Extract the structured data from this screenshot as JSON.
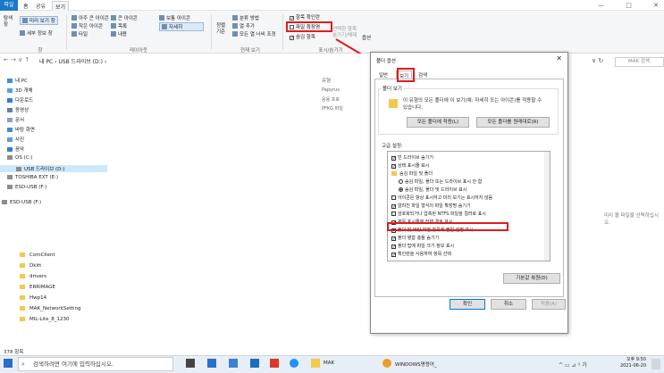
{
  "ribbon_tabs": {
    "file": "파일",
    "home": "홈",
    "share": "공유",
    "view": "보기"
  },
  "ribbon": {
    "nav_pane": "탐색\n창",
    "preview": "미리 보기 창",
    "details_pane": "세부 정보 창",
    "pane_group": "창",
    "layout": {
      "xl_icons": "아주 큰 아이콘",
      "large_icons": "큰 아이콘",
      "medium_icons": "보통 아이콘",
      "small_icons": "작은 아이콘",
      "list": "목록",
      "details": "자세히",
      "tiles": "타일",
      "content": "내용",
      "group": "레이아웃"
    },
    "current_view": {
      "sort": "정렬\n기준",
      "group_by": "분류 방법",
      "add_columns": "열 추가",
      "fit_columns": "모든 열 너비 조정",
      "group": "현재 보기"
    },
    "show_hide": {
      "item_checkboxes": "항목 확인란",
      "file_extensions": "파일 확장명",
      "hidden_items": "숨김 항목",
      "hide_selected": "선택한 항목\n숨기기/해제",
      "options": "옵션",
      "group": "표시/숨기기"
    }
  },
  "window_controls": {
    "min": "—",
    "max": "□",
    "close": "✕"
  },
  "address": {
    "path": "내 PC  ›  USB 드라이브 (D:)  ›",
    "search": "MAK 검색"
  },
  "nav_pane": {
    "items": [
      "내 PC",
      "3D 개체",
      "다운로드",
      "동영상",
      "문서",
      "바탕 화면",
      "사진",
      "음악",
      "OS (C:)",
      "USB 드라이브 (D:)",
      "TOSHIBA EXT (E:)",
      "ESD-USB (F:)",
      "ESD-USB (F:)"
    ]
  },
  "list": {
    "column_type": "유형",
    "extra1": "Papyrus",
    "extra2": "응용 프로",
    "extra3": "PFKG 파일",
    "folders": [
      "ComClient",
      "Dkitt",
      "drivers",
      "ERRIMAGE",
      "Hwp14",
      "MAK_NetworkSetting",
      "MIL-Lite_8_1230"
    ],
    "status": "378 항목",
    "preview_msg": "미리 볼 파일을 선택하십시오."
  },
  "dialog": {
    "title": "폴더 옵션",
    "tabs": [
      "일반",
      "보기",
      "검색"
    ],
    "folder_view_title": "폴더 보기",
    "folder_view_desc": "이 유형의 모든 폴더에 이 보기(예: 자세히 또는 아이콘)를 적용할 수 있습니다.",
    "apply_all": "모든 폴더에 적용(L)",
    "reset_all": "모든 폴더를 원래대로(R)",
    "advanced_title": "고급 설정:",
    "advanced": [
      {
        "type": "check",
        "on": true,
        "text": "빈 드라이브 숨기기"
      },
      {
        "type": "check",
        "on": true,
        "text": "상태 표시줄 표시"
      },
      {
        "type": "folder",
        "on": false,
        "text": "숨김 파일 및 폴더"
      },
      {
        "type": "radio",
        "on": false,
        "text": "숨김 파일, 폴더 또는 드라이브 표시 안 함"
      },
      {
        "type": "radio",
        "on": true,
        "text": "숨김 파일, 폴더 및 드라이브 표시"
      },
      {
        "type": "check",
        "on": false,
        "text": "아이콘은 항상 표시하고 미리 보기는 표시하지 않음"
      },
      {
        "type": "check",
        "on": true,
        "text": "알려진 파일 형식의 파일 확장명 숨기기"
      },
      {
        "type": "check",
        "on": false,
        "text": "암호화되거나 압축된 NTFS 파일을 컬러로 표시"
      },
      {
        "type": "check",
        "on": true,
        "text": "제목 표시줄에 전체 경로 표시"
      },
      {
        "type": "check",
        "on": true,
        "text": "폴더 및 바탕 화면 항목에 팝업 설명 표시"
      },
      {
        "type": "check",
        "on": true,
        "text": "폴더 병합 충돌 숨기기"
      },
      {
        "type": "check",
        "on": true,
        "text": "폴더 팁에 파일 크기 정보 표시"
      },
      {
        "type": "check",
        "on": true,
        "text": "확인란을 사용하여 항목 선택"
      }
    ],
    "restore_defaults": "기본값 복원(D)",
    "ok": "확인",
    "cancel": "취소",
    "apply": "적용(A)"
  },
  "taskbar": {
    "search_placeholder": "검색하려면 여기에 입력하십시오.",
    "mak": "MAK",
    "chrome": "WINDOWS명령어_",
    "time": "오후 9:50",
    "date": "2021-06-20"
  },
  "colors": {
    "accent": "#1979ca",
    "highlight": "#e21b1b",
    "folder": "#f2c94c"
  }
}
